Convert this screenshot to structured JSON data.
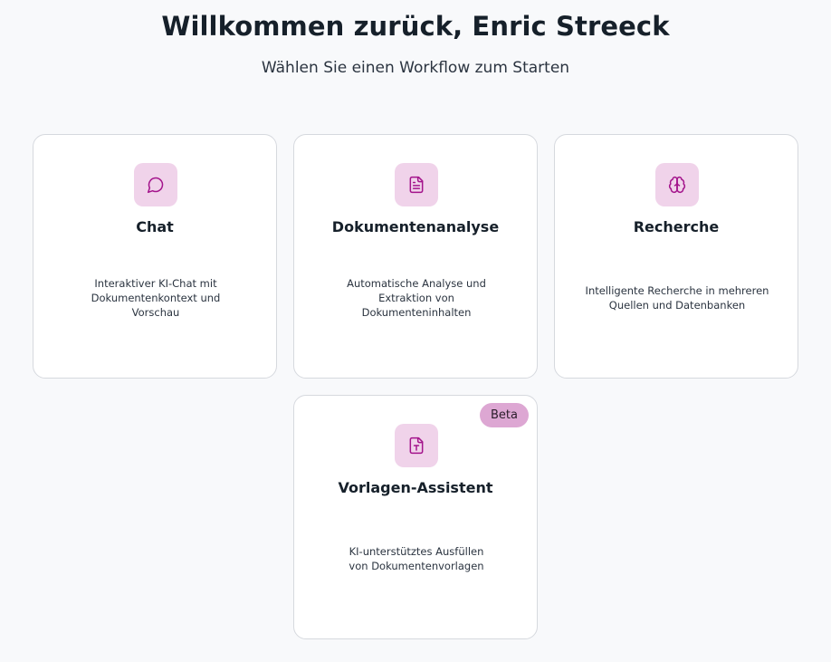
{
  "header": {
    "title": "Willkommen zurück, Enric Streeck",
    "subtitle": "Wählen Sie einen Workflow zum Starten"
  },
  "workflows": [
    {
      "title": "Chat",
      "description": "Interaktiver KI-Chat mit Dokumentenkontext und Vorschau",
      "icon": "chat-bubble-icon"
    },
    {
      "title": "Dokumentenanalyse",
      "description": "Automatische Analyse und Extraktion von Dokumenteninhalten",
      "icon": "document-icon"
    },
    {
      "title": "Recherche",
      "description": "Intelligente Recherche in mehreren Quellen und Datenbanken",
      "icon": "brain-icon"
    },
    {
      "title": "Vorlagen-Assistent",
      "description": "KI-unterstütztes Ausfüllen von Dokumentenvorlagen",
      "icon": "template-document-icon",
      "badge": "Beta"
    }
  ],
  "colors": {
    "background": "#f8f9fb",
    "icon_bg": "#f0d3ea",
    "icon_stroke": "#a4148c",
    "badge_bg": "#dda7d3"
  }
}
